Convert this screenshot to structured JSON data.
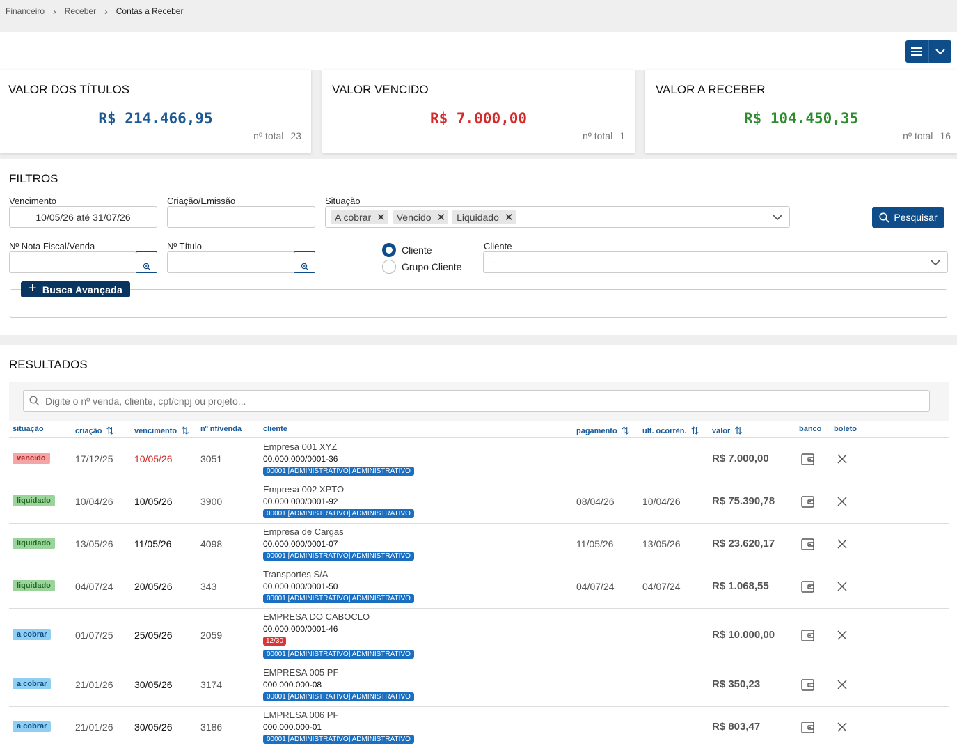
{
  "breadcrumb": [
    "Financeiro",
    "Receber",
    "Contas a Receber"
  ],
  "cards": [
    {
      "title": "VALOR DOS TÍTULOS",
      "value": "R$ 214.466,95",
      "total_label": "nº total",
      "total": "23",
      "color": "#1d5a93"
    },
    {
      "title": "VALOR VENCIDO",
      "value": "R$ 7.000,00",
      "total_label": "nº total",
      "total": "1",
      "color": "#d42a2a"
    },
    {
      "title": "VALOR A RECEBER",
      "value": "R$ 104.450,35",
      "total_label": "nº total",
      "total": "16",
      "color": "#2e8b2e"
    }
  ],
  "filters": {
    "title": "FILTROS",
    "vencimento_label": "Vencimento",
    "vencimento_value": "10/05/26 até 31/07/26",
    "criacao_label": "Criação/Emissão",
    "situacao_label": "Situação",
    "situacao_chips": [
      "A cobrar",
      "Vencido",
      "Liquidado"
    ],
    "search_button": "Pesquisar",
    "nota_label": "Nº Nota Fiscal/Venda",
    "titulo_label": "Nº Título",
    "radio_cliente": "Cliente",
    "radio_grupo": "Grupo Cliente",
    "cliente_label": "Cliente",
    "cliente_value": "--",
    "advanced_button": "Busca Avançada"
  },
  "results": {
    "title": "RESULTADOS",
    "search_placeholder": "Digite o nº venda, cliente, cpf/cnpj ou projeto...",
    "columns": {
      "situacao": "situação",
      "criacao": "criação",
      "vencimento": "vencimento",
      "nf": "nº nf/venda",
      "cliente": "cliente",
      "pagamento": "pagamento",
      "ocorrencia": "ult. ocorrên.",
      "valor": "valor",
      "banco": "banco",
      "boleto": "boleto"
    },
    "rows": [
      {
        "status": "vencido",
        "status_class": "vencido",
        "criacao": "17/12/25",
        "vencimento": "10/05/26",
        "venc_overdue": true,
        "nf": "3051",
        "cliente": "Empresa 001 XYZ",
        "doc": "00.000.000/0001-36",
        "parcela": "",
        "tag": "00001 [ADMINISTRATIVO] ADMINISTRATIVO",
        "pagamento": "",
        "ocorrencia": "",
        "valor": "R$ 7.000,00"
      },
      {
        "status": "liquidado",
        "status_class": "liquidado",
        "criacao": "10/04/26",
        "vencimento": "10/05/26",
        "venc_overdue": false,
        "nf": "3900",
        "cliente": "Empresa 002 XPTO",
        "doc": "00.000.000/0001-92",
        "parcela": "",
        "tag": "00001 [ADMINISTRATIVO] ADMINISTRATIVO",
        "pagamento": "08/04/26",
        "ocorrencia": "10/04/26",
        "valor": "R$ 75.390,78"
      },
      {
        "status": "liquidado",
        "status_class": "liquidado",
        "criacao": "13/05/26",
        "vencimento": "11/05/26",
        "venc_overdue": false,
        "nf": "4098",
        "cliente": "Empresa de Cargas",
        "doc": "00.000.000/0001-07",
        "parcela": "",
        "tag": "00001 [ADMINISTRATIVO] ADMINISTRATIVO",
        "pagamento": "11/05/26",
        "ocorrencia": "13/05/26",
        "valor": "R$ 23.620,17"
      },
      {
        "status": "liquidado",
        "status_class": "liquidado",
        "criacao": "04/07/24",
        "vencimento": "20/05/26",
        "venc_overdue": false,
        "nf": "343",
        "cliente": "Transportes S/A",
        "doc": "00.000.000/0001-50",
        "parcela": "",
        "tag": "00001 [ADMINISTRATIVO] ADMINISTRATIVO",
        "pagamento": "04/07/24",
        "ocorrencia": "04/07/24",
        "valor": "R$ 1.068,55"
      },
      {
        "status": "a cobrar",
        "status_class": "acobrar",
        "criacao": "01/07/25",
        "vencimento": "25/05/26",
        "venc_overdue": false,
        "nf": "2059",
        "cliente": "EMPRESA DO CABOCLO",
        "doc": "00.000.000/0001-46",
        "parcela": "12/30",
        "tag": "00001 [ADMINISTRATIVO] ADMINISTRATIVO",
        "pagamento": "",
        "ocorrencia": "",
        "valor": "R$ 10.000,00"
      },
      {
        "status": "a cobrar",
        "status_class": "acobrar",
        "criacao": "21/01/26",
        "vencimento": "30/05/26",
        "venc_overdue": false,
        "nf": "3174",
        "cliente": "EMPRESA 005 PF",
        "doc": "000.000.000-08",
        "parcela": "",
        "tag": "00001 [ADMINISTRATIVO] ADMINISTRATIVO",
        "pagamento": "",
        "ocorrencia": "",
        "valor": "R$ 350,23"
      },
      {
        "status": "a cobrar",
        "status_class": "acobrar",
        "criacao": "21/01/26",
        "vencimento": "30/05/26",
        "venc_overdue": false,
        "nf": "3186",
        "cliente": "EMPRESA 006 PF",
        "doc": "000.000.000-01",
        "parcela": "",
        "tag": "00001 [ADMINISTRATIVO] ADMINISTRATIVO",
        "pagamento": "",
        "ocorrencia": "",
        "valor": "R$ 803,47"
      }
    ]
  },
  "icons": {
    "menu": "hamburger-icon",
    "dropdown": "chevron-down-icon",
    "search": "magnifier-icon",
    "banco": "wallet-icon",
    "boleto": "close-icon"
  }
}
